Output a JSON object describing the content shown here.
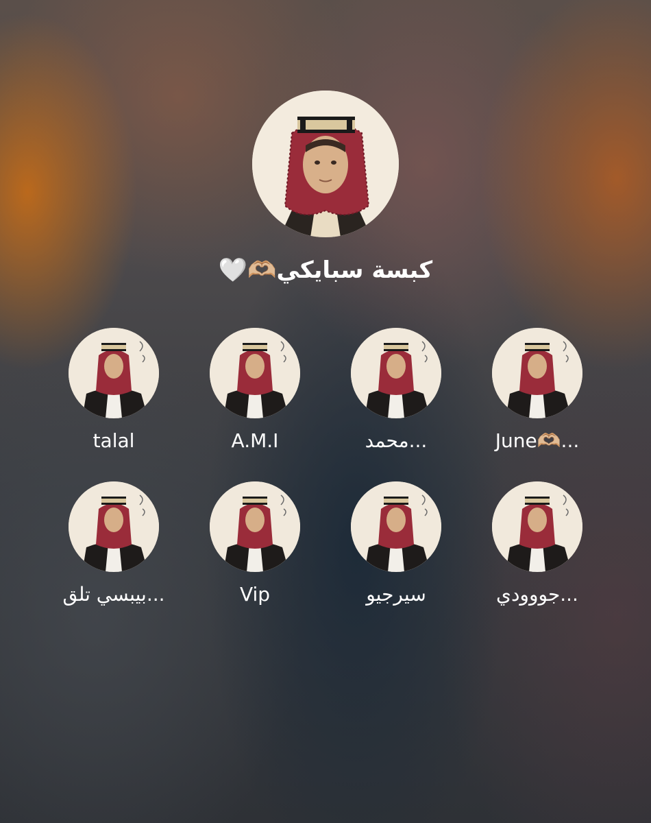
{
  "profile": {
    "name": "كبسة سبايكي🫶🏼🤍",
    "avatar_icon": "person-in-shemagh-icon"
  },
  "contacts": [
    {
      "name": "talal",
      "avatar_icon": "person-in-shemagh-icon"
    },
    {
      "name": "A.M.I",
      "avatar_icon": "person-in-shemagh-icon"
    },
    {
      "name": "محمد...",
      "avatar_icon": "person-in-shemagh-icon"
    },
    {
      "name": "June🫶🏼...",
      "avatar_icon": "person-in-shemagh-icon"
    },
    {
      "name": "بيبسي تلق...",
      "avatar_icon": "person-in-shemagh-icon"
    },
    {
      "name": "Vip",
      "avatar_icon": "person-in-shemagh-icon"
    },
    {
      "name": "سيرجيو",
      "avatar_icon": "person-in-shemagh-icon"
    },
    {
      "name": "جووودي...",
      "avatar_icon": "person-in-shemagh-icon"
    }
  ],
  "colors": {
    "text": "#ffffff",
    "shemagh_red": "#9a2c3a",
    "agal_black": "#1a1a1a",
    "avatar_bg": "#f3ebde"
  }
}
